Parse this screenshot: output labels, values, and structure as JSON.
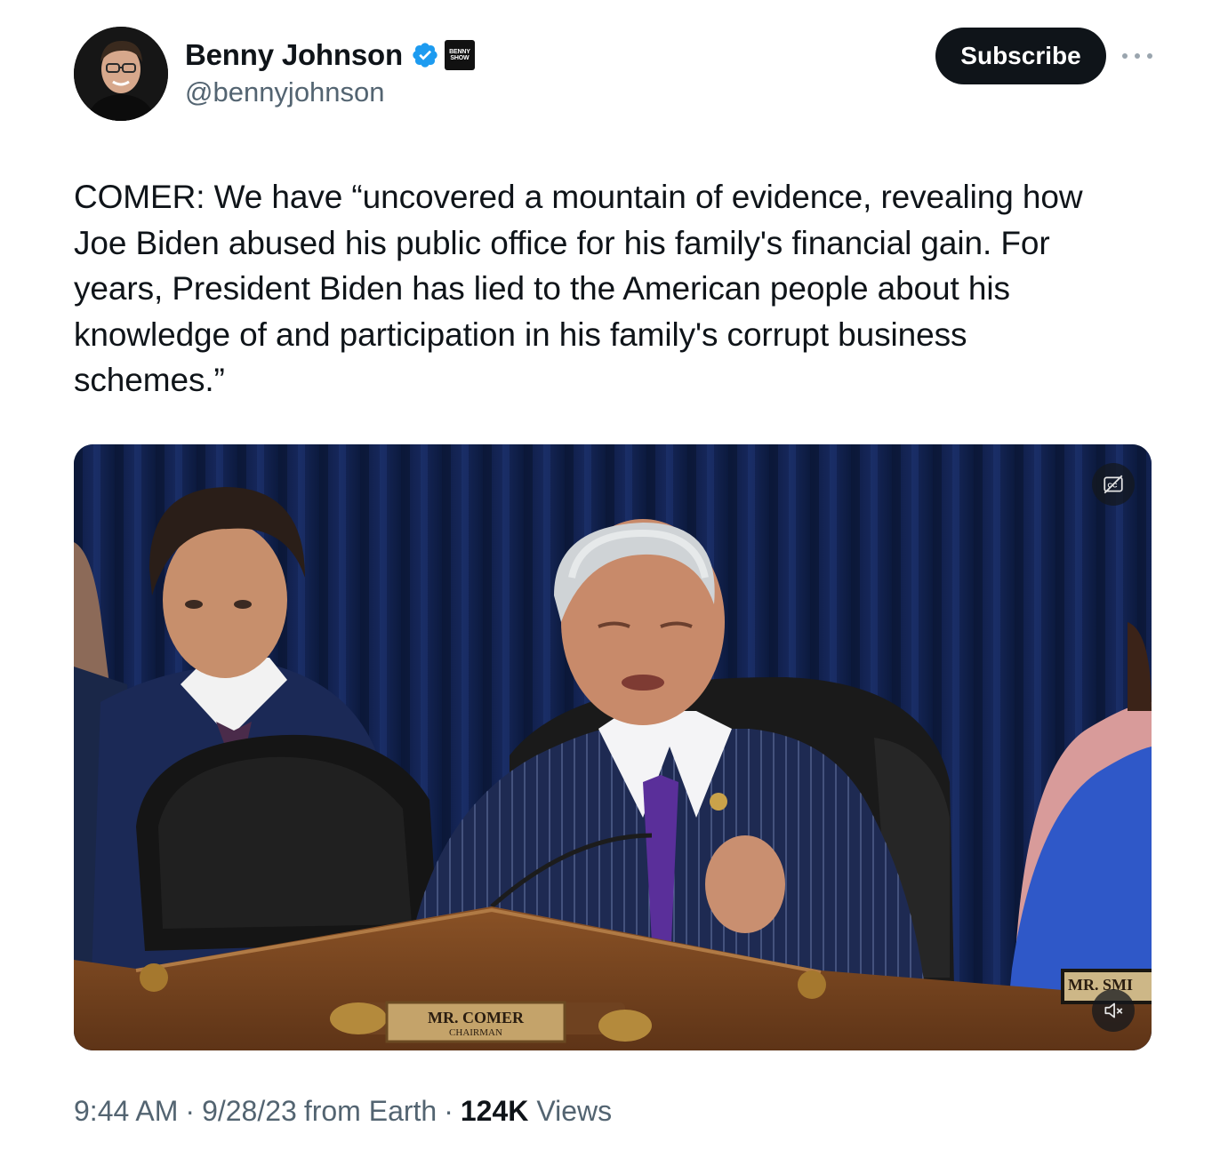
{
  "author": {
    "display_name": "Benny Johnson",
    "handle": "@bennyjohnson",
    "verified": true,
    "affiliate_badge": [
      "BENNY",
      "SHOW"
    ]
  },
  "actions": {
    "subscribe_label": "Subscribe",
    "more_icon": "more-horizontal-icon"
  },
  "tweet": {
    "text": "COMER: We have “uncovered a mountain of evidence, revealing how\nJoe Biden abused his public office for his family's financial gain. For\nyears, President Biden has lied to the American people about his\nknowledge of and participation in his family's corrupt business\nschemes.”"
  },
  "media": {
    "type": "video",
    "nameplate_main": "MR. COMER",
    "nameplate_sub": "CHAIRMAN",
    "nameplate_right": "MR. SMI",
    "captions_icon": "closed-captions-icon",
    "mute_icon": "volume-muted-icon"
  },
  "meta": {
    "time": "9:44 AM",
    "date": "9/28/23",
    "source": "from Earth",
    "views_count": "124K",
    "views_label": "Views",
    "separator": "·"
  },
  "colors": {
    "verified_blue": "#1d9bf0",
    "primary_text": "#0f1419",
    "secondary_text": "#536471",
    "button_bg": "#0f1419"
  }
}
